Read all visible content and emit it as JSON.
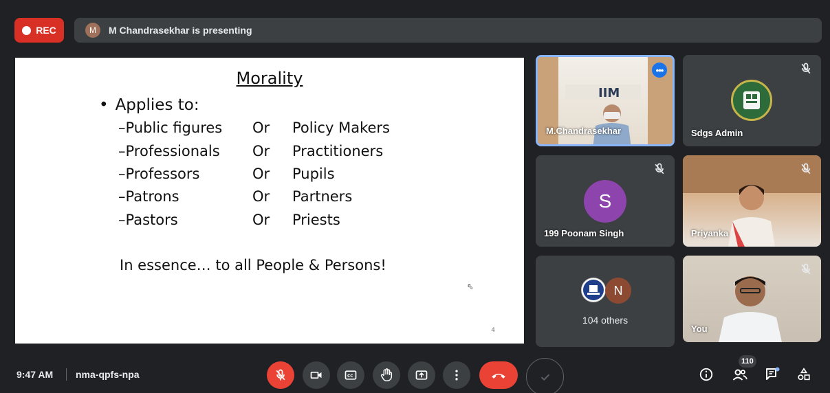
{
  "top": {
    "rec_label": "REC",
    "presenter_initial": "M",
    "presenting_text": "M Chandrasekhar is presenting"
  },
  "slide": {
    "title": "Morality",
    "bullet": "Applies to:",
    "rows": [
      {
        "left": "–Public figures",
        "or": "Or",
        "right": "Policy Makers"
      },
      {
        "left": "–Professionals",
        "or": "Or",
        "right": "Practitioners"
      },
      {
        "left": "–Professors",
        "or": "Or",
        "right": "Pupils"
      },
      {
        "left": "–Patrons",
        "or": "Or",
        "right": "Partners"
      },
      {
        "left": "–Pastors",
        "or": "Or",
        "right": "Priests"
      }
    ],
    "essence": "In essence… to all People & Persons!",
    "page_number": "4"
  },
  "participants": {
    "chandrasekhar": "M.Chandrasekhar",
    "sdgs": "Sdgs Admin",
    "poonam": "199 Poonam Singh",
    "poonam_initial": "S",
    "priyanka": "Priyanka",
    "others_label": "104 others",
    "others_initial": "N",
    "you": "You"
  },
  "bottom": {
    "time": "9:47 AM",
    "meeting_code": "nma-qpfs-npa",
    "people_count": "110"
  },
  "colors": {
    "rec": "#d93025",
    "hangup": "#ea4335",
    "active_speaker": "#8ab4f8",
    "avatar_purple": "#8e44ad"
  }
}
